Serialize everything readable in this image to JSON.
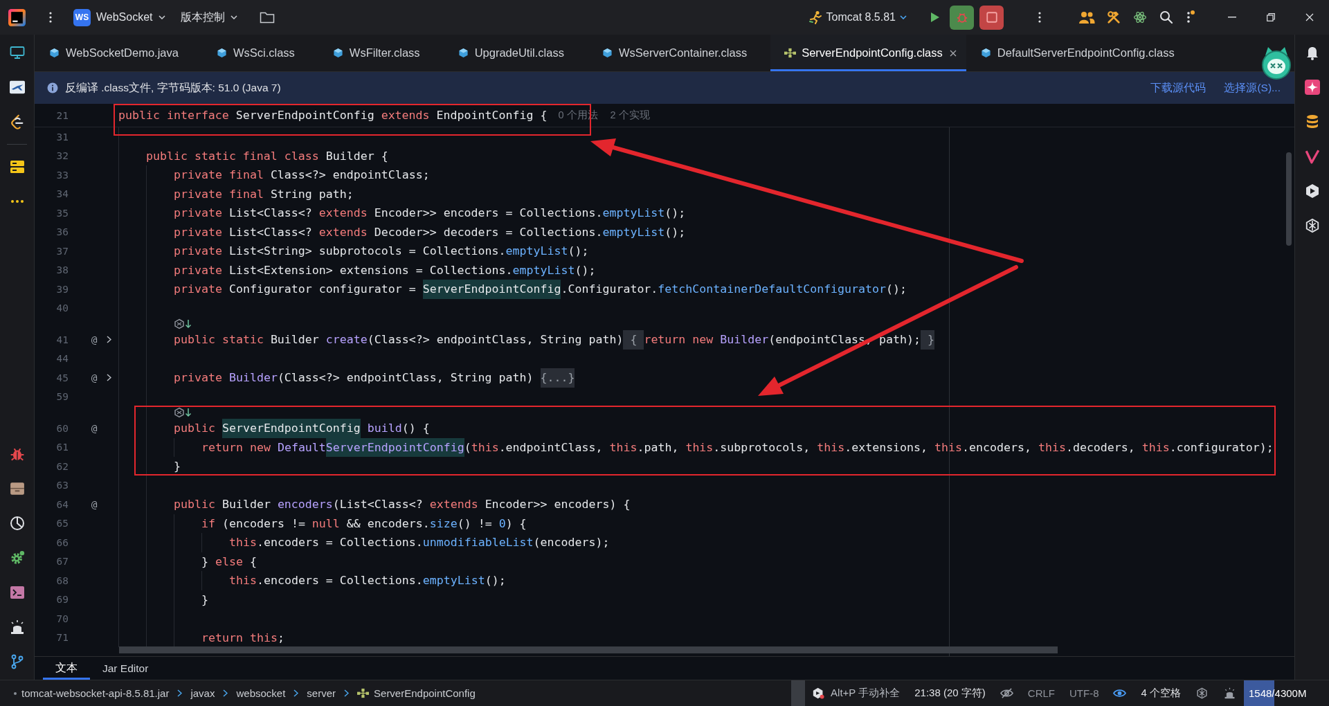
{
  "title_bar": {
    "project_badge": "WS",
    "project": "WebSocket",
    "vcs_menu": "版本控制",
    "run_configuration": "Tomcat 8.5.81"
  },
  "editor_tabs": [
    {
      "label": "WebSocketDemo.java",
      "kind": "class",
      "selected": false
    },
    {
      "label": "WsSci.class",
      "kind": "class",
      "selected": false
    },
    {
      "label": "WsFilter.class",
      "kind": "class",
      "selected": false
    },
    {
      "label": "UpgradeUtil.class",
      "kind": "class",
      "selected": false
    },
    {
      "label": "WsServerContainer.class",
      "kind": "class",
      "selected": false
    },
    {
      "label": "ServerEndpointConfig.class",
      "kind": "interface",
      "selected": true
    },
    {
      "label": "DefaultServerEndpointConfig.class",
      "kind": "class",
      "selected": false
    }
  ],
  "info_bar": {
    "message": "反编译 .class文件, 字节码版本: 51.0 (Java 7)",
    "links": [
      "下载源代码",
      "选择源(S)..."
    ]
  },
  "editor": {
    "sticky_line": {
      "number": "21",
      "tokens": [
        {
          "text": "public interface ",
          "kind": "kw"
        },
        {
          "text": "ServerEndpointConfig ",
          "kind": "plain"
        },
        {
          "text": "extends ",
          "kind": "kw"
        },
        {
          "text": "EndpointConfig {",
          "kind": "plain"
        }
      ],
      "hints": [
        "0 个用法",
        "2 个实现"
      ]
    },
    "lines": [
      {
        "kind": "code",
        "number": "31",
        "folded": false
      },
      {
        "kind": "code",
        "number": "32",
        "folded": false,
        "tokens": [
          {
            "text": "    public static final class ",
            "kind": "kw"
          },
          {
            "text": "Builder {",
            "kind": "plain"
          }
        ]
      },
      {
        "kind": "code",
        "number": "33",
        "folded": false,
        "tokens": [
          {
            "text": "        private final ",
            "kind": "kw"
          },
          {
            "text": "Class<?> endpointClass;",
            "kind": "plain"
          }
        ]
      },
      {
        "kind": "code",
        "number": "34",
        "folded": false,
        "tokens": [
          {
            "text": "        private final ",
            "kind": "kw"
          },
          {
            "text": "String path;",
            "kind": "plain"
          }
        ]
      },
      {
        "kind": "code",
        "number": "35",
        "folded": false,
        "tokens": [
          {
            "text": "        private ",
            "kind": "kw"
          },
          {
            "text": "List<Class<? ",
            "kind": "plain"
          },
          {
            "text": "extends ",
            "kind": "kw"
          },
          {
            "text": "Encoder>> encoders = Collections.",
            "kind": "plain"
          },
          {
            "text": "emptyList",
            "kind": "call"
          },
          {
            "text": "();",
            "kind": "plain"
          }
        ]
      },
      {
        "kind": "code",
        "number": "36",
        "folded": false,
        "tokens": [
          {
            "text": "        private ",
            "kind": "kw"
          },
          {
            "text": "List<Class<? ",
            "kind": "plain"
          },
          {
            "text": "extends ",
            "kind": "kw"
          },
          {
            "text": "Decoder>> decoders = Collections.",
            "kind": "plain"
          },
          {
            "text": "emptyList",
            "kind": "call"
          },
          {
            "text": "();",
            "kind": "plain"
          }
        ]
      },
      {
        "kind": "code",
        "number": "37",
        "folded": false,
        "tokens": [
          {
            "text": "        private ",
            "kind": "kw"
          },
          {
            "text": "List<String> subprotocols = Collections.",
            "kind": "plain"
          },
          {
            "text": "emptyList",
            "kind": "call"
          },
          {
            "text": "();",
            "kind": "plain"
          }
        ]
      },
      {
        "kind": "code",
        "number": "38",
        "folded": false,
        "tokens": [
          {
            "text": "        private ",
            "kind": "kw"
          },
          {
            "text": "List<Extension> extensions = Collections.",
            "kind": "plain"
          },
          {
            "text": "emptyList",
            "kind": "call"
          },
          {
            "text": "();",
            "kind": "plain"
          }
        ]
      },
      {
        "kind": "code",
        "number": "39",
        "folded": false,
        "tokens": [
          {
            "text": "        private ",
            "kind": "kw"
          },
          {
            "text": "Configurator configurator = ",
            "kind": "plain"
          },
          {
            "text": "ServerEndpointConfig",
            "kind": "ref"
          },
          {
            "text": ".Configurator.",
            "kind": "plain"
          },
          {
            "text": "fetchContainerDefaultConfigurator",
            "kind": "call"
          },
          {
            "text": "();",
            "kind": "plain"
          }
        ]
      },
      {
        "kind": "code",
        "number": "40",
        "folded": false
      },
      {
        "kind": "hint"
      },
      {
        "kind": "code",
        "number": "41",
        "gutter_mark": "@",
        "folded": true,
        "tokens": [
          {
            "text": "        public static ",
            "kind": "kw"
          },
          {
            "text": "Builder ",
            "kind": "plain"
          },
          {
            "text": "create",
            "kind": "decl"
          },
          {
            "text": "(Class<?> endpointClass, String path)",
            "kind": "plain"
          },
          {
            "text": " { ",
            "kind": "fold"
          },
          {
            "text": "return new ",
            "kind": "kw"
          },
          {
            "text": "Builder",
            "kind": "decl"
          },
          {
            "text": "(endpointClass, path);",
            "kind": "plain"
          },
          {
            "text": " }",
            "kind": "fold"
          }
        ]
      },
      {
        "kind": "code",
        "number": "44",
        "folded": false
      },
      {
        "kind": "code",
        "number": "45",
        "gutter_mark": "@",
        "folded": true,
        "tokens": [
          {
            "text": "        private ",
            "kind": "kw"
          },
          {
            "text": "Builder",
            "kind": "decl"
          },
          {
            "text": "(Class<?> endpointClass, String path) ",
            "kind": "plain"
          },
          {
            "text": "{...}",
            "kind": "fold"
          }
        ]
      },
      {
        "kind": "code",
        "number": "59",
        "folded": false
      },
      {
        "kind": "hint"
      },
      {
        "kind": "code",
        "number": "60",
        "gutter_mark": "@",
        "folded": false,
        "tokens": [
          {
            "text": "        public ",
            "kind": "kw"
          },
          {
            "text": "ServerEndpointConfig",
            "kind": "ref"
          },
          {
            "text": " build",
            "kind": "decl"
          },
          {
            "text": "() {",
            "kind": "plain"
          }
        ]
      },
      {
        "kind": "code",
        "number": "61",
        "folded": false,
        "tokens": [
          {
            "text": "            return new ",
            "kind": "kw"
          },
          {
            "text": "Default",
            "kind": "decl"
          },
          {
            "text": "ServerEndpointConfig",
            "kind": "decl_ref"
          },
          {
            "text": "(",
            "kind": "plain"
          },
          {
            "text": "this",
            "kind": "kw"
          },
          {
            "text": ".endpointClass, ",
            "kind": "plain"
          },
          {
            "text": "this",
            "kind": "kw"
          },
          {
            "text": ".path, ",
            "kind": "plain"
          },
          {
            "text": "this",
            "kind": "kw"
          },
          {
            "text": ".subprotocols, ",
            "kind": "plain"
          },
          {
            "text": "this",
            "kind": "kw"
          },
          {
            "text": ".extensions, ",
            "kind": "plain"
          },
          {
            "text": "this",
            "kind": "kw"
          },
          {
            "text": ".encoders, ",
            "kind": "plain"
          },
          {
            "text": "this",
            "kind": "kw"
          },
          {
            "text": ".decoders, ",
            "kind": "plain"
          },
          {
            "text": "this",
            "kind": "kw"
          },
          {
            "text": ".configurator);",
            "kind": "plain"
          }
        ]
      },
      {
        "kind": "code",
        "number": "62",
        "folded": false,
        "tokens": [
          {
            "text": "        }",
            "kind": "plain"
          }
        ]
      },
      {
        "kind": "code",
        "number": "63",
        "folded": false
      },
      {
        "kind": "code",
        "number": "64",
        "gutter_mark": "@",
        "folded": false,
        "tokens": [
          {
            "text": "        public ",
            "kind": "kw"
          },
          {
            "text": "Builder ",
            "kind": "plain"
          },
          {
            "text": "encoders",
            "kind": "decl"
          },
          {
            "text": "(List<Class<? ",
            "kind": "plain"
          },
          {
            "text": "extends ",
            "kind": "kw"
          },
          {
            "text": "Encoder>> encoders) {",
            "kind": "plain"
          }
        ]
      },
      {
        "kind": "code",
        "number": "65",
        "folded": false,
        "tokens": [
          {
            "text": "            if ",
            "kind": "kw"
          },
          {
            "text": "(encoders != ",
            "kind": "plain"
          },
          {
            "text": "null",
            "kind": "kw"
          },
          {
            "text": " && encoders.",
            "kind": "plain"
          },
          {
            "text": "size",
            "kind": "call"
          },
          {
            "text": "() != ",
            "kind": "plain"
          },
          {
            "text": "0",
            "kind": "num"
          },
          {
            "text": ") {",
            "kind": "plain"
          }
        ]
      },
      {
        "kind": "code",
        "number": "66",
        "folded": false,
        "tokens": [
          {
            "text": "                this",
            "kind": "kw"
          },
          {
            "text": ".encoders = Collections.",
            "kind": "plain"
          },
          {
            "text": "unmodifiableList",
            "kind": "call"
          },
          {
            "text": "(encoders);",
            "kind": "plain"
          }
        ]
      },
      {
        "kind": "code",
        "number": "67",
        "folded": false,
        "tokens": [
          {
            "text": "            } ",
            "kind": "plain"
          },
          {
            "text": "else",
            "kind": "kw"
          },
          {
            "text": " {",
            "kind": "plain"
          }
        ]
      },
      {
        "kind": "code",
        "number": "68",
        "folded": false,
        "tokens": [
          {
            "text": "                this",
            "kind": "kw"
          },
          {
            "text": ".encoders = Collections.",
            "kind": "plain"
          },
          {
            "text": "emptyList",
            "kind": "call"
          },
          {
            "text": "();",
            "kind": "plain"
          }
        ]
      },
      {
        "kind": "code",
        "number": "69",
        "folded": false,
        "tokens": [
          {
            "text": "            }",
            "kind": "plain"
          }
        ]
      },
      {
        "kind": "code",
        "number": "70",
        "folded": false
      },
      {
        "kind": "code",
        "number": "71",
        "folded": false,
        "tokens": [
          {
            "text": "            return this",
            "kind": "kw"
          },
          {
            "text": ";",
            "kind": "plain"
          }
        ]
      }
    ]
  },
  "bottom_tabs": [
    {
      "label": "文本",
      "selected": true
    },
    {
      "label": "Jar Editor",
      "selected": false
    }
  ],
  "status_bar": {
    "breadcrumbs": [
      {
        "label": "tomcat-websocket-api-8.5.81.jar",
        "kind": "jar"
      },
      {
        "label": "javax",
        "kind": "package"
      },
      {
        "label": "websocket",
        "kind": "package"
      },
      {
        "label": "server",
        "kind": "package"
      },
      {
        "label": "ServerEndpointConfig",
        "kind": "interface"
      }
    ],
    "completion_hint": "Alt+P 手动补全",
    "caret_position": "21:38 (20 字符)",
    "line_separator": "CRLF",
    "encoding": "UTF-8",
    "indent": "4 个空格",
    "memory": {
      "reading": "1548/4300M",
      "level": 0.36
    }
  }
}
